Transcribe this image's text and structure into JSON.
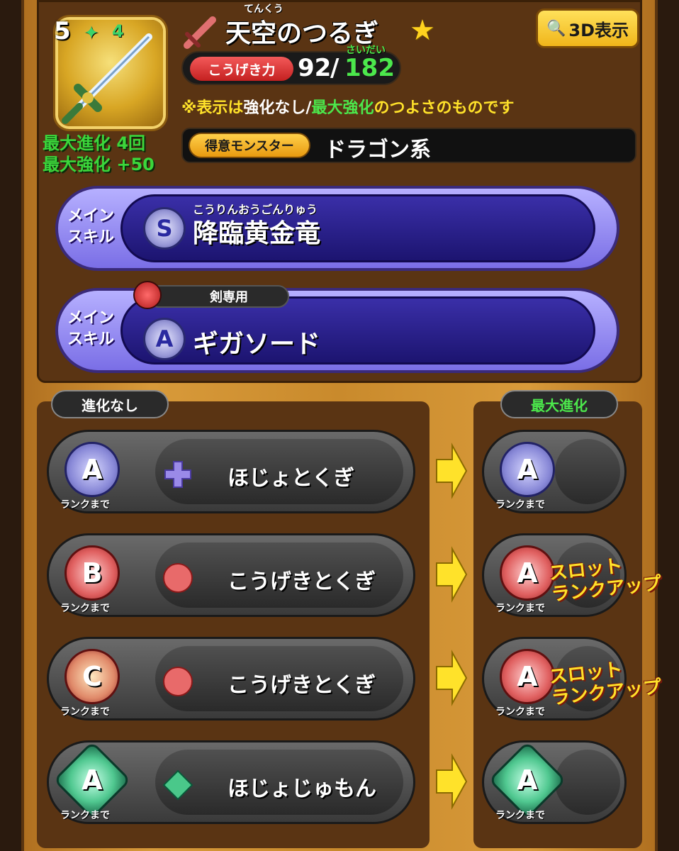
{
  "item": {
    "rank": "5",
    "plus_level": "4",
    "furigana": "てんくう",
    "name": "天空のつるぎ",
    "max_evolution": "最大進化 4回",
    "max_enhance": "最大強化 +50"
  },
  "view_3d_button": "3D表示",
  "attack": {
    "label": "こうげき力",
    "value": "92",
    "slash": "/",
    "max_furigana": "さいだい",
    "max_value": "182"
  },
  "note": {
    "prefix": "※表示は",
    "mid1": "強化なし/",
    "mid2": "最大強化",
    "suffix": "のつよさのものです"
  },
  "monster": {
    "label": "得意モンスター",
    "value": "ドラゴン系"
  },
  "skills": [
    {
      "tag_line1": "メイン",
      "tag_line2": "スキル",
      "rank": "S",
      "furigana": "こうりんおうごんりゅう",
      "name": "降臨黄金竜"
    },
    {
      "tag_line1": "メイン",
      "tag_line2": "スキル",
      "rank": "A",
      "restriction": "剣専用",
      "name": "ギガソード"
    }
  ],
  "sections": {
    "left_label": "進化なし",
    "right_label": "最大進化"
  },
  "slots": [
    {
      "rank_before": "A",
      "rank_label": "ランクまで",
      "gem": "purple-cross-gem",
      "name": "ほじょとくぎ",
      "rank_after": "A",
      "upgrade": ""
    },
    {
      "rank_before": "B",
      "rank_label": "ランクまで",
      "gem": "red-orb-gem",
      "name": "こうげきとくぎ",
      "rank_after": "A",
      "upgrade_line1": "スロット",
      "upgrade_line2": "ランクアップ"
    },
    {
      "rank_before": "C",
      "rank_label": "ランクまで",
      "gem": "red-orb-gem",
      "name": "こうげきとくぎ",
      "rank_after": "A",
      "upgrade_line1": "スロット",
      "upgrade_line2": "ランクアップ"
    },
    {
      "rank_before": "A",
      "rank_label": "ランクまで",
      "gem": "green-diamond-gem",
      "name": "ほじょじゅもん",
      "rank_after": "A",
      "upgrade": ""
    }
  ],
  "colors": {
    "accent_green": "#4ce84c",
    "accent_yellow": "#ffe22a",
    "skill_purple": "#7a6ee6"
  }
}
